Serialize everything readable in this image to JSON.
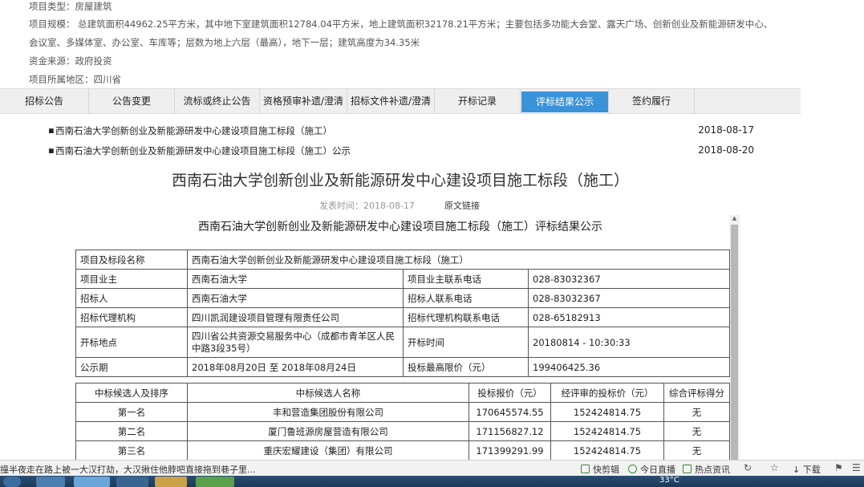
{
  "info": {
    "line1": "项目类型：房屋建筑",
    "line2": "项目规模： 总建筑面积44962.25平方米，其中地下室建筑面积12784.04平方米，地上建筑面积32178.21平方米；主要包括多功能大会堂、露天广场、创新创业及新能源研发中心、",
    "line3": "会议室、多媒体室、办公室、车库等；层数为地上六层（最高），地下一层；建筑高度为34.35米",
    "line4": "资金来源：政府投资",
    "line5": "项目所属地区：四川省"
  },
  "tabs": [
    {
      "label": "招标公告"
    },
    {
      "label": "公告变更"
    },
    {
      "label": "流标或终止公告"
    },
    {
      "label": "资格预审补遗/澄清"
    },
    {
      "label": "招标文件补遗/澄清"
    },
    {
      "label": "开标记录"
    },
    {
      "label": "评标结果公示"
    },
    {
      "label": "签约履行"
    }
  ],
  "notices": [
    {
      "bullet": "▪",
      "title": "西南石油大学创新创业及新能源研发中心建设项目施工标段（施工）",
      "date": "2018-08-17"
    },
    {
      "bullet": "▪",
      "title": "西南石油大学创新创业及新能源研发中心建设项目施工标段（施工）公示",
      "date": "2018-08-20"
    }
  ],
  "article": {
    "title": "西南石油大学创新创业及新能源研发中心建设项目施工标段（施工）",
    "publish_time": "发表时间：2018-08-17",
    "source_link": "原文链接",
    "subtitle": "西南石油大学创新创业及新能源研发中心建设项目施工标段（施工）评标结果公示"
  },
  "table": {
    "project_name_label": "项目及标段名称",
    "project_name": "西南石油大学创新创业及新能源研发中心建设项目施工标段（施工）",
    "owner_label": "项目业主",
    "owner": "西南石油大学",
    "owner_phone_label": "项目业主联系电话",
    "owner_phone": "028-83032367",
    "tenderer_label": "招标人",
    "tenderer": "西南石油大学",
    "tenderer_phone_label": "招标人联系电话",
    "tenderer_phone": "028-83032367",
    "agency_label": "招标代理机构",
    "agency": "四川凯润建设项目管理有限责任公司",
    "agency_phone_label": "招标代理机构联系电话",
    "agency_phone": "028-65182913",
    "venue_label": "开标地点",
    "venue_line1": "四川省公共资源交易服务中心（成都市青羊区人民",
    "venue_line2": "中路3段35号）",
    "open_time_label": "开标时间",
    "open_time": "20180814 - 10:30:33",
    "period_label": "公示期",
    "period": "2018年08月20日 至 2018年08月24日",
    "max_price_label": "投标最高限价（元）",
    "max_price": "199406425.36",
    "headers": [
      "中标候选人及排序",
      "中标候选人名称",
      "投标报价（元）",
      "经评审的投标价（元）",
      "综合评标得分"
    ],
    "candidates": [
      {
        "rank": "第一名",
        "name": "丰和营造集团股份有限公司",
        "bid": "170645574.55",
        "evaluated": "152424814.75",
        "score": "无"
      },
      {
        "rank": "第二名",
        "name": "厦门鲁班源房屋营造有限公司",
        "bid": "171156827.12",
        "evaluated": "152424814.75",
        "score": "无"
      },
      {
        "rank": "第三名",
        "name": "重庆宏耀建设（集团）有限公司",
        "bid": "171399291.99",
        "evaluated": "152424814.75",
        "score": "无"
      }
    ]
  },
  "statusbar": {
    "ticker": "撞半夜走在路上被一大汉打劫，大汉揪住他脖吧直接拖到巷子里...",
    "items": [
      {
        "label": "快剪辑",
        "icon": "scissors-icon"
      },
      {
        "label": "今日直播",
        "icon": "play-icon"
      },
      {
        "label": "热点资讯",
        "icon": "news-icon"
      },
      {
        "label": "下载",
        "icon": "download-icon"
      }
    ]
  },
  "taskbar": {
    "temperature": "33°C"
  }
}
